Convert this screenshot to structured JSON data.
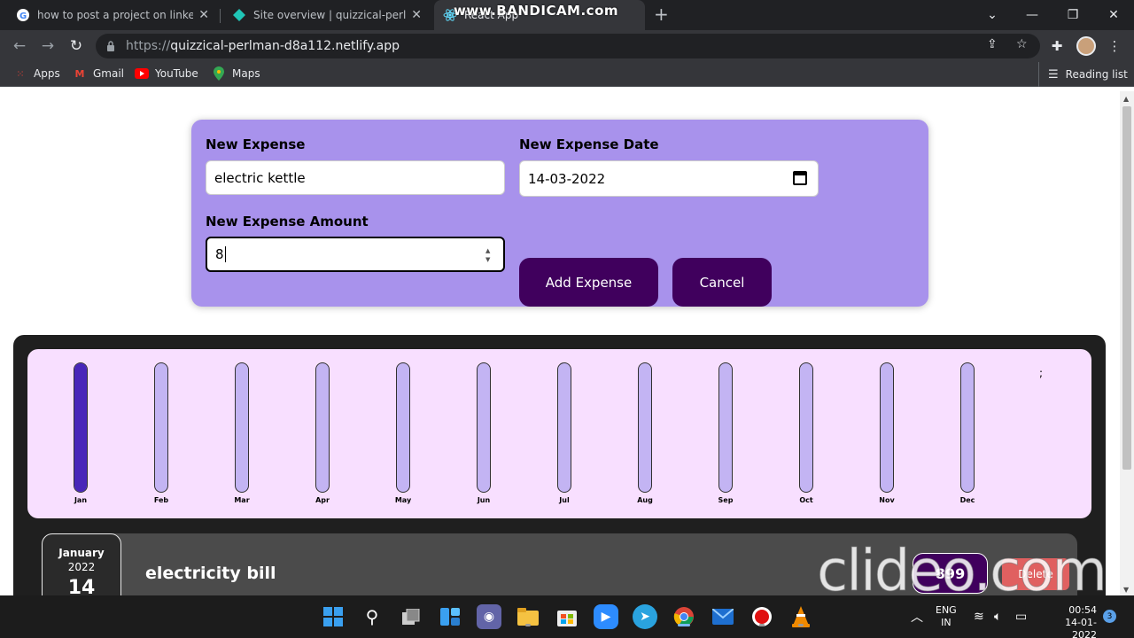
{
  "browser": {
    "tabs": [
      {
        "label": "how to post a project on linkedin",
        "icon": "google-icon"
      },
      {
        "label": "Site overview | quizzical-perlman",
        "icon": "netlify-icon"
      },
      {
        "label": "React App",
        "icon": "react-icon"
      }
    ],
    "watermark": "www.BANDICAM.com",
    "url_scheme": "https://",
    "url_host": "quizzical-perlman-d8a112.netlify.app",
    "bookmarks": [
      {
        "label": "Apps",
        "icon": "apps-grid-icon"
      },
      {
        "label": "Gmail",
        "icon": "gmail-icon"
      },
      {
        "label": "YouTube",
        "icon": "youtube-icon"
      },
      {
        "label": "Maps",
        "icon": "maps-icon"
      }
    ],
    "reading_list": "Reading list"
  },
  "form": {
    "title_label": "New Expense",
    "title_value": "electric kettle",
    "date_label": "New Expense Date",
    "date_value": "14-03-2022",
    "amount_label": "New Expense Amount",
    "amount_value": "8",
    "add_button": "Add Expense",
    "cancel_button": "Cancel"
  },
  "chart_data": {
    "type": "bar",
    "categories": [
      "Jan",
      "Feb",
      "Mar",
      "Apr",
      "May",
      "Jun",
      "Jul",
      "Aug",
      "Sep",
      "Oct",
      "Nov",
      "Dec"
    ],
    "values": [
      1,
      0,
      0,
      0,
      0,
      0,
      0,
      0,
      0,
      0,
      0,
      0
    ],
    "ylim": [
      0,
      1
    ],
    "fill_color": "#4826b9",
    "empty_color": "#c3b4f3",
    "stray_text": ";"
  },
  "expense_item": {
    "month": "January",
    "year": "2022",
    "day": "14",
    "title": "electricity bill",
    "price": "899",
    "delete_label": "Delete"
  },
  "overlay_watermark": "clideo.com",
  "taskbar": {
    "lang_top": "ENG",
    "lang_bottom": "IN",
    "time": "00:54",
    "date": "14-01-2022",
    "notifications": "3"
  }
}
